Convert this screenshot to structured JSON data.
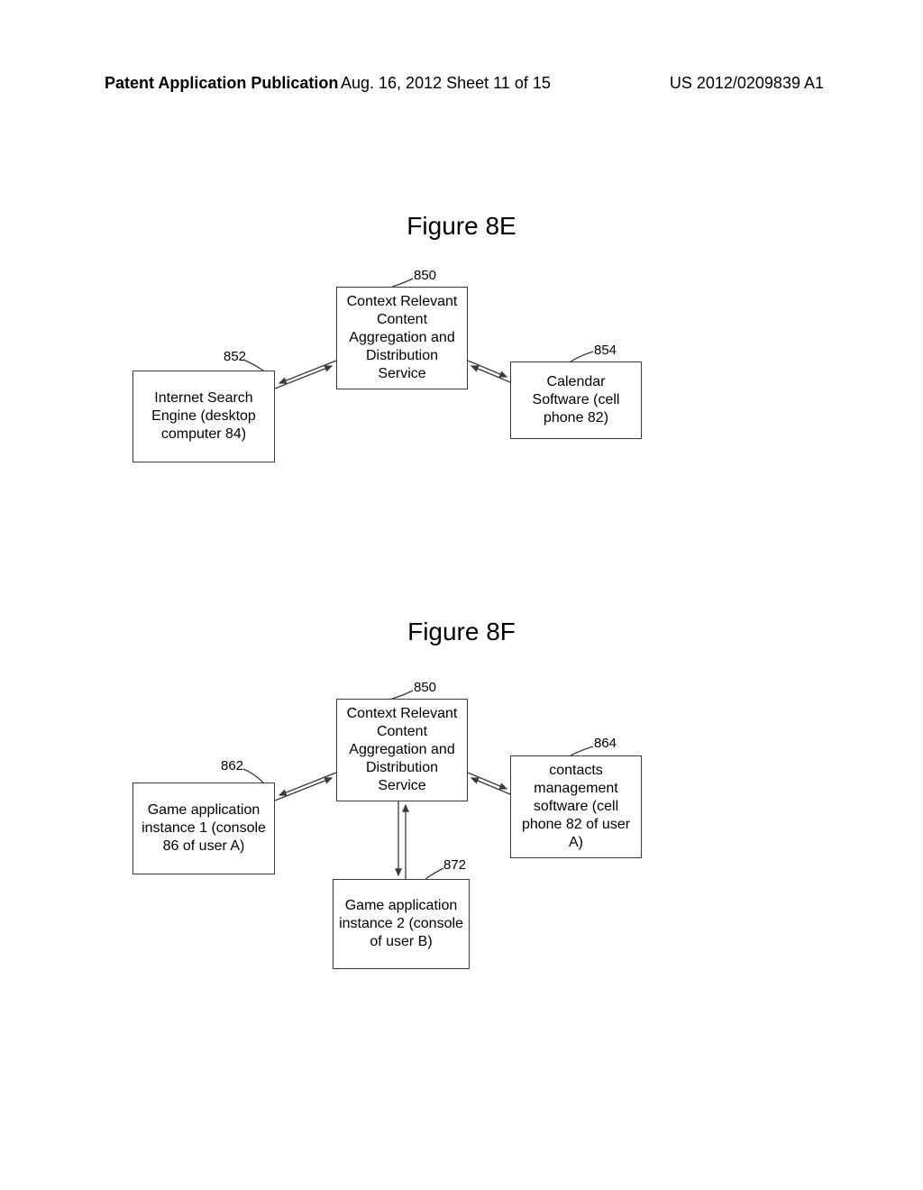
{
  "header": {
    "left": "Patent Application Publication",
    "mid": "Aug. 16, 2012  Sheet 11 of 15",
    "right": "US 2012/0209839 A1"
  },
  "figures": {
    "e": {
      "title": "Figure 8E",
      "service": {
        "label": "Context Relevant Content Aggregation and Distribution Service",
        "ref": "850"
      },
      "left": {
        "label": "Internet Search Engine (desktop computer 84)",
        "ref": "852"
      },
      "right": {
        "label": "Calendar Software (cell phone 82)",
        "ref": "854"
      }
    },
    "f": {
      "title": "Figure 8F",
      "service": {
        "label": "Context Relevant Content Aggregation and Distribution Service",
        "ref": "850"
      },
      "left": {
        "label": "Game application instance 1 (console 86 of user A)",
        "ref": "862"
      },
      "right": {
        "label": "contacts management software (cell phone 82 of user A)",
        "ref": "864"
      },
      "bottom": {
        "label": "Game application instance 2 (console of user B)",
        "ref": "872"
      }
    }
  }
}
